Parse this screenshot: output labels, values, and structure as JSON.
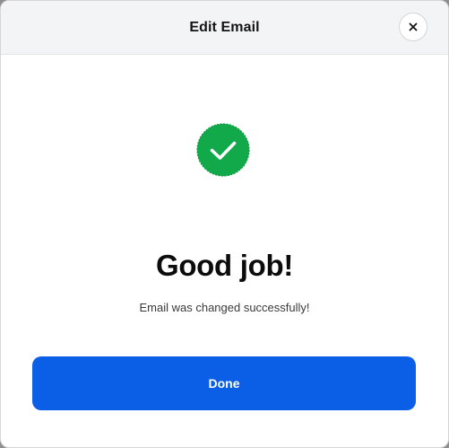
{
  "dialog": {
    "title": "Edit Email",
    "close_label": "×",
    "close_icon": "close-icon"
  },
  "success": {
    "icon": "check-circle-icon",
    "headline": "Good job!",
    "message": "Email was changed successfully!"
  },
  "actions": {
    "done_label": "Done"
  },
  "colors": {
    "header_bg": "#f3f4f6",
    "success_green": "#12a94a",
    "primary_blue": "#0b5fe6"
  }
}
